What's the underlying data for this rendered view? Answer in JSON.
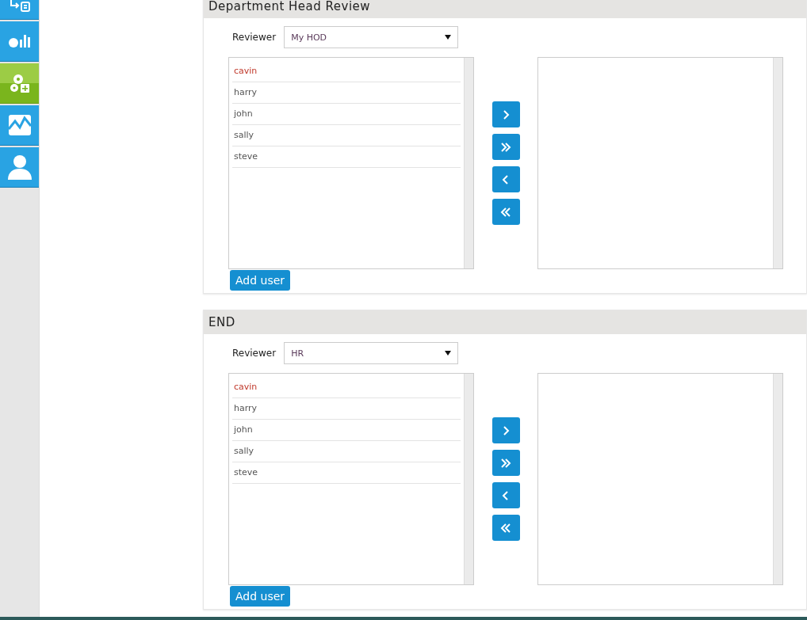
{
  "sidebar": {
    "items": [
      {
        "kind": "workflow",
        "selected": false
      },
      {
        "kind": "charts",
        "selected": false
      },
      {
        "kind": "settings",
        "selected": true
      },
      {
        "kind": "trend",
        "selected": false
      },
      {
        "kind": "user",
        "selected": false
      }
    ]
  },
  "sections": [
    {
      "title": "Department Head Review",
      "reviewer_label": "Reviewer",
      "reviewer": "My HOD",
      "available": [
        {
          "name": "cavin",
          "selected": true
        },
        {
          "name": "harry",
          "selected": false
        },
        {
          "name": "john",
          "selected": false
        },
        {
          "name": "sally",
          "selected": false
        },
        {
          "name": "steve",
          "selected": false
        }
      ],
      "move_buttons": [
        {
          "kind": "right"
        },
        {
          "kind": "all-right"
        },
        {
          "kind": "left"
        },
        {
          "kind": "all-left"
        }
      ],
      "add_button": "Add user"
    },
    {
      "title": "END",
      "reviewer_label": "Reviewer",
      "reviewer": "HR",
      "available": [
        {
          "name": "cavin",
          "selected": true
        },
        {
          "name": "harry",
          "selected": false
        },
        {
          "name": "john",
          "selected": false
        },
        {
          "name": "sally",
          "selected": false
        },
        {
          "name": "steve",
          "selected": false
        }
      ],
      "move_buttons": [
        {
          "kind": "right"
        },
        {
          "kind": "all-right"
        },
        {
          "kind": "left"
        },
        {
          "kind": "all-left"
        }
      ],
      "add_button": "Add user"
    }
  ]
}
